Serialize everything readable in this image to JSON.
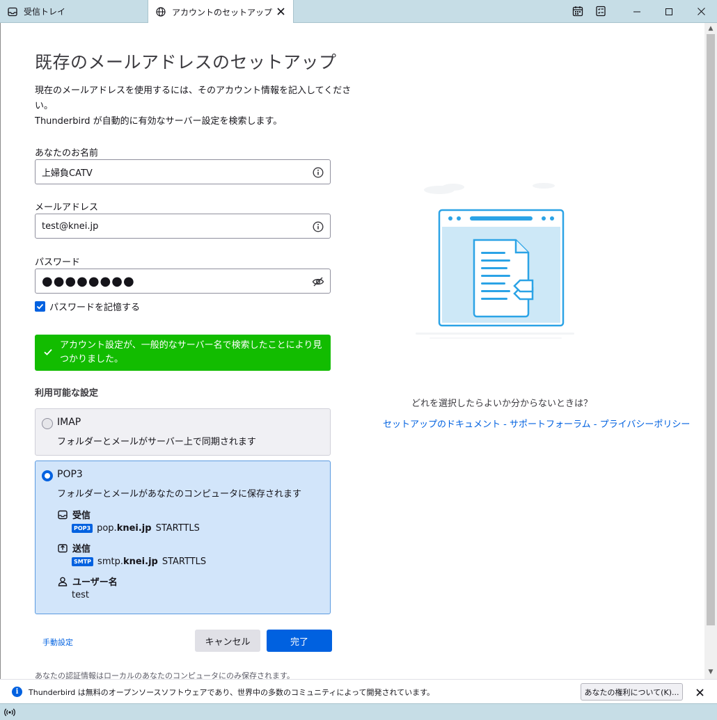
{
  "tabs": [
    {
      "label": "受信トレイ"
    },
    {
      "label": "アカウントのセットアップ"
    }
  ],
  "page": {
    "title": "既存のメールアドレスのセットアップ",
    "intro_line1": "現在のメールアドレスを使用するには、そのアカウント情報を記入してください。",
    "intro_line2": "Thunderbird が自動的に有効なサーバー設定を検索します。"
  },
  "form": {
    "name_label": "あなたのお名前",
    "name_value": "上婦負CATV",
    "email_label": "メールアドレス",
    "email_value": "test@knei.jp",
    "password_label": "パスワード",
    "password_masked": "●●●●●●●●",
    "remember_label": "パスワードを記憶する",
    "remember_checked": true
  },
  "success_message": "アカウント設定が、一般的なサーバー名で検索したことにより見つかりました。",
  "available": {
    "title": "利用可能な設定",
    "imap": {
      "name": "IMAP",
      "desc": "フォルダーとメールがサーバー上で同期されます",
      "selected": false
    },
    "pop3": {
      "name": "POP3",
      "desc": "フォルダーとメールがあなたのコンピュータに保存されます",
      "selected": true,
      "incoming_label": "受信",
      "incoming_badge": "POP3",
      "incoming_host_prefix": "pop.",
      "incoming_host_domain": "knei.jp",
      "incoming_security": "STARTTLS",
      "outgoing_label": "送信",
      "outgoing_badge": "SMTP",
      "outgoing_host_prefix": "smtp.",
      "outgoing_host_domain": "knei.jp",
      "outgoing_security": "STARTTLS",
      "username_label": "ユーザー名",
      "username_value": "test"
    }
  },
  "actions": {
    "manual": "手動設定",
    "cancel": "キャンセル",
    "done": "完了"
  },
  "footer_note": "あなたの認証情報はローカルのあなたのコンピュータにのみ保存されます。",
  "help": {
    "question": "どれを選択したらよいか分からないときは？",
    "link_docs": "セットアップのドキュメント",
    "link_forum": "サポートフォーラム",
    "link_privacy": "プライバシーポリシー",
    "separator": " - "
  },
  "notification": {
    "text": "Thunderbird は無料のオープンソースソフトウェアであり、世界中の多数のコミュニティによって開発されています。",
    "button": "あなたの権利について(K)..."
  },
  "colors": {
    "accent": "#0061e0",
    "success": "#12bc00",
    "tabbar": "#c6dde6"
  }
}
